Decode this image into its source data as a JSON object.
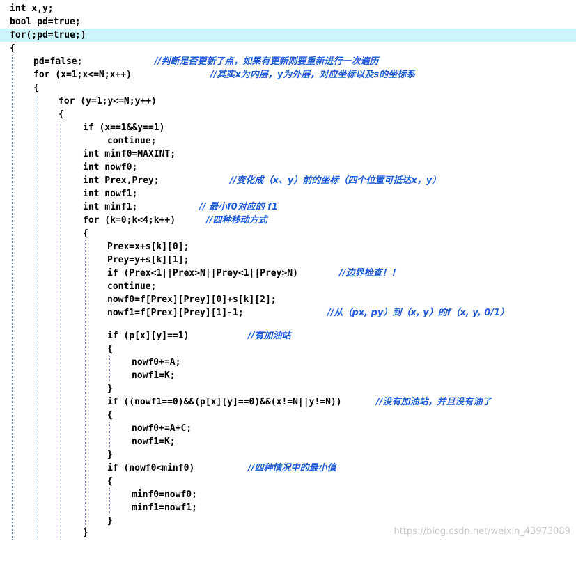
{
  "colors": {
    "highlight": "#cdf5fc",
    "comment": "#1e5bd6",
    "code": "#000000",
    "guide": "#6a8cc8",
    "watermark": "#c8c8c8"
  },
  "lines": [
    {
      "code": "int x,y;",
      "comment": ""
    },
    {
      "code": "bool pd=true;",
      "comment": ""
    },
    {
      "code": "for(;pd=true;)",
      "comment": ""
    },
    {
      "code": "{",
      "comment": ""
    },
    {
      "code": "pd=false;",
      "comment": "//判断是否更新了点，如果有更新则要重新进行一次遍历"
    },
    {
      "code": "for (x=1;x<=N;x++)",
      "comment": "//其实x为内层，y为外层，对应坐标以及s的坐标系"
    },
    {
      "code": "{",
      "comment": ""
    },
    {
      "code": "for (y=1;y<=N;y++)",
      "comment": ""
    },
    {
      "code": "{",
      "comment": ""
    },
    {
      "code": "if (x==1&&y==1)",
      "comment": ""
    },
    {
      "code": "continue;",
      "comment": ""
    },
    {
      "code": "int minf0=MAXINT;",
      "comment": ""
    },
    {
      "code": "int nowf0;",
      "comment": ""
    },
    {
      "code": "int Prex,Prey;",
      "comment": "//变化成（x、y）前的坐标（四个位置可抵达x，y）"
    },
    {
      "code": "int nowf1;",
      "comment": ""
    },
    {
      "code": "int minf1;",
      "comment": "// 最小f0对应的 f1"
    },
    {
      "code": "for (k=0;k<4;k++)",
      "comment": "//四种移动方式"
    },
    {
      "code": "{",
      "comment": ""
    },
    {
      "code": "Prex=x+s[k][0];",
      "comment": ""
    },
    {
      "code": "Prey=y+s[k][1];",
      "comment": ""
    },
    {
      "code": "if (Prex<1||Prex>N||Prey<1||Prey>N)",
      "comment": "//边界检查！！"
    },
    {
      "code": "continue;",
      "comment": ""
    },
    {
      "code": "nowf0=f[Prex][Prey][0]+s[k][2];",
      "comment": ""
    },
    {
      "code": "nowf1=f[Prex][Prey][1]-1;",
      "comment": "//从（px, py）到（x, y）的f（x, y, 0/1）"
    },
    {
      "code": "",
      "comment": ""
    },
    {
      "code": "if (p[x][y]==1)",
      "comment": "//有加油站"
    },
    {
      "code": "{",
      "comment": ""
    },
    {
      "code": "nowf0+=A;",
      "comment": ""
    },
    {
      "code": "nowf1=K;",
      "comment": ""
    },
    {
      "code": "}",
      "comment": ""
    },
    {
      "code": "if ((nowf1==0)&&(p[x][y]==0)&&(x!=N||y!=N))",
      "comment": "//没有加油站，并且没有油了"
    },
    {
      "code": "{",
      "comment": ""
    },
    {
      "code": "nowf0+=A+C;",
      "comment": ""
    },
    {
      "code": "nowf1=K;",
      "comment": ""
    },
    {
      "code": "}",
      "comment": ""
    },
    {
      "code": "if (nowf0<minf0)",
      "comment": "//四种情况中的最小值"
    },
    {
      "code": "{",
      "comment": ""
    },
    {
      "code": "minf0=nowf0;",
      "comment": ""
    },
    {
      "code": "minf1=nowf1;",
      "comment": ""
    },
    {
      "code": "}",
      "comment": ""
    },
    {
      "code": "}",
      "comment": ""
    }
  ],
  "watermark": "https://blog.csdn.net/weixin_43973089"
}
